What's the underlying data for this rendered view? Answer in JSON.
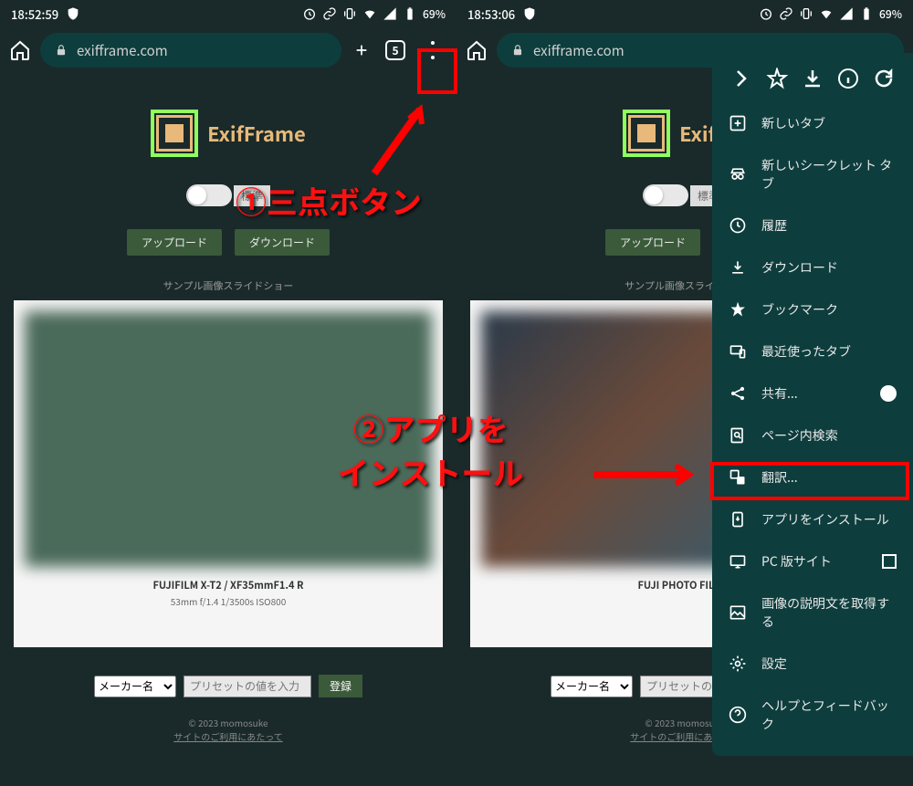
{
  "status_bar": {
    "time_left": "18:52:59",
    "time_right": "18:53:06",
    "battery": "69%"
  },
  "browser": {
    "url": "exifframe.com",
    "tab_count": "5"
  },
  "app": {
    "name": "ExifFrame",
    "toggle_label": "標準",
    "upload_btn": "アップロード",
    "download_btn": "ダウンロード",
    "slideshow_label": "サンプル画像スライドショー",
    "photo1_line1": "FUJIFILM X-T2 / XF35mmF1.4 R",
    "photo1_line2": "53mm f/1.4 1/3500s ISO800",
    "photo2_line1": "FUJI PHOTO FILM C",
    "preset_select": "メーカー名",
    "preset_placeholder": "プリセットの値を入力",
    "preset_btn": "登録",
    "footer_copyright": "© 2023 momosuke",
    "footer_link": "サイトのご利用にあたって"
  },
  "menu": {
    "new_tab": "新しいタブ",
    "incognito": "新しいシークレット タブ",
    "history": "履歴",
    "downloads": "ダウンロード",
    "bookmarks": "ブックマーク",
    "recent_tabs": "最近使ったタブ",
    "share": "共有...",
    "find": "ページ内検索",
    "translate": "翻訳...",
    "install": "アプリをインストール",
    "desktop": "PC 版サイト",
    "image_desc": "画像の説明文を取得する",
    "settings": "設定",
    "help": "ヘルプとフィードバック"
  },
  "annotations": {
    "label1": "①三点ボタン",
    "label2_a": "②アプリを",
    "label2_b": "インストール"
  }
}
